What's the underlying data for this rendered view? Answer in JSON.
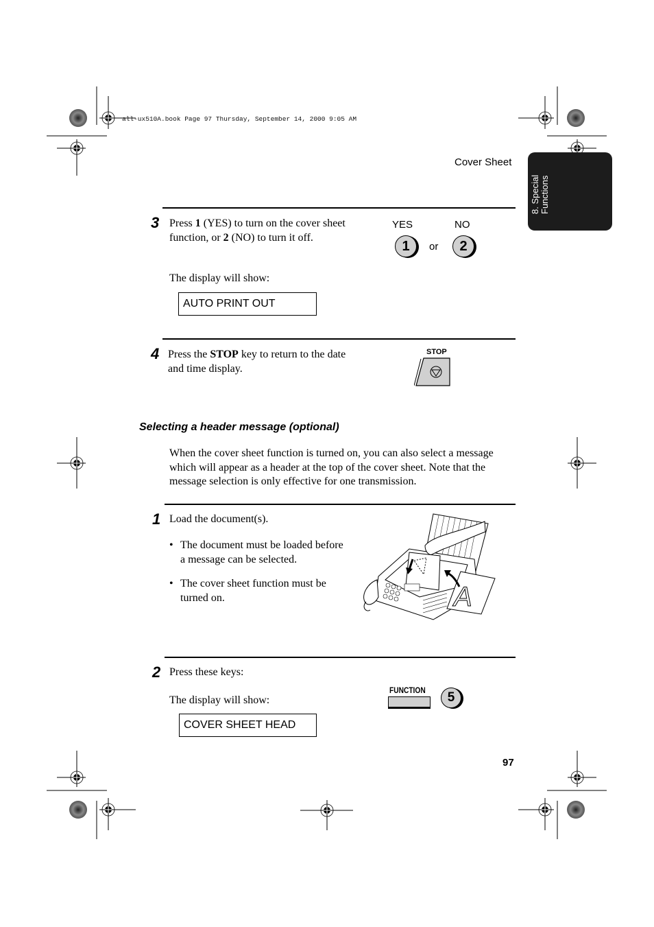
{
  "print_header": {
    "text": "all-ux510A.book  Page 97  Thursday, September 14, 2000  9:05 AM"
  },
  "running_head": "Cover Sheet",
  "side_tab": {
    "line1": "8. Special",
    "line2": "Functions"
  },
  "steps_top": [
    {
      "number": "3",
      "text_parts": [
        "Press ",
        "1",
        " (YES) to turn on the cover sheet function, or ",
        "2",
        " (NO) to turn it off."
      ],
      "display_intro": "The display will show:",
      "display_value": "AUTO PRINT OUT",
      "keys": {
        "yes_label": "YES",
        "no_label": "NO",
        "key1": "1",
        "key2": "2",
        "or_text": "or"
      }
    },
    {
      "number": "4",
      "text_parts": [
        "Press the ",
        "STOP",
        " key to return to the date and time display."
      ],
      "key_label": "STOP"
    }
  ],
  "section": {
    "heading": "Selecting a header message (optional)",
    "intro": "When the cover sheet function is turned on, you can also select a message which will appear as a header at the top of the cover sheet. Note that the message selection is only effective for one transmission."
  },
  "steps_bottom": [
    {
      "number": "1",
      "text": "Load the document(s).",
      "bullets": [
        "The document must be loaded before a message can be selected.",
        "The cover sheet function must be turned on."
      ],
      "illustration": "fax-machine-loading-document"
    },
    {
      "number": "2",
      "text": "Press these keys:",
      "display_intro": "The display will show:",
      "display_value": "COVER SHEET HEAD",
      "keys": {
        "function_label": "FUNCTION",
        "key5": "5"
      }
    }
  ],
  "page_number": "97"
}
